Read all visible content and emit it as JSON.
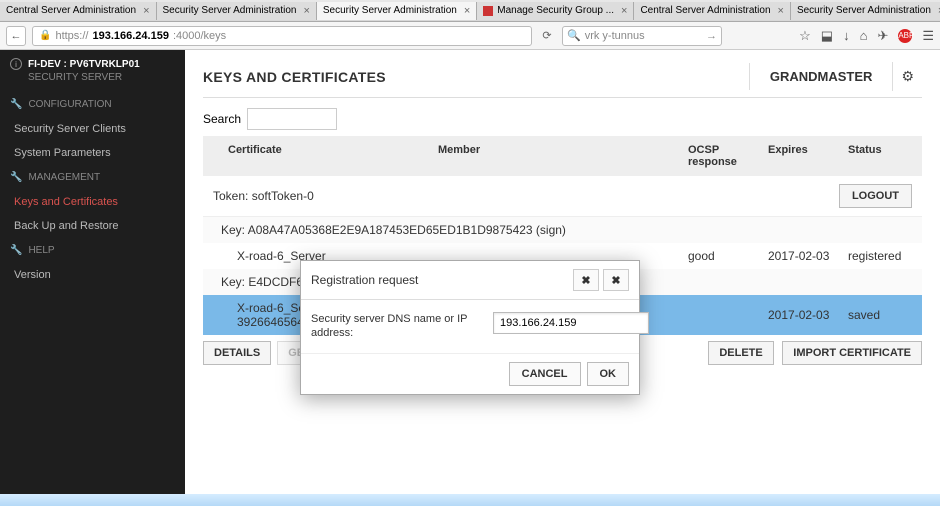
{
  "browser": {
    "tabs": [
      {
        "label": "Central Server Administration"
      },
      {
        "label": "Security Server Administration"
      },
      {
        "label": "Security Server Administration",
        "active": true
      },
      {
        "label": "Manage Security Group ..."
      },
      {
        "label": "Central Server Administration"
      },
      {
        "label": "Security Server Administration"
      }
    ],
    "url_host": "193.166.24.159",
    "url_port_path": ":4000/keys",
    "url_prefix": "https://",
    "search_placeholder": "vrk y-tunnus"
  },
  "sidebar": {
    "env": "FI-DEV : PV6TVRKLP01",
    "role": "SECURITY SERVER",
    "sections": {
      "config_label": "CONFIGURATION",
      "mgmt_label": "MANAGEMENT",
      "help_label": "HELP"
    },
    "items": {
      "clients": "Security Server Clients",
      "params": "System Parameters",
      "keys": "Keys and Certificates",
      "backup": "Back Up and Restore",
      "version": "Version"
    }
  },
  "header": {
    "title": "KEYS AND CERTIFICATES",
    "user": "GRANDMASTER"
  },
  "search_label": "Search",
  "columns": {
    "cert": "Certificate",
    "member": "Member",
    "ocsp": "OCSP response",
    "expires": "Expires",
    "status": "Status"
  },
  "token": {
    "label_prefix": "Token: ",
    "name": "softToken-0",
    "logout": "LOGOUT"
  },
  "keys": {
    "key1_prefix": "Key: ",
    "key1": "A08A47A05368E2E9A187453ED65ED1B1D9875423 (sign)",
    "key2_prefix": "Key: ",
    "key2": "E4DCDF6471F"
  },
  "rows": {
    "r1": {
      "cert": "X-road-6_Server",
      "ocsp": "good",
      "expires": "2017-02-03",
      "status": "registered"
    },
    "r2": {
      "cert": "X-road-6_Server",
      "cert2": "3926646564512",
      "expires": "2017-02-03",
      "status": "saved"
    }
  },
  "actions": {
    "details": "DETAILS",
    "genera": "GENERA",
    "delete": "DELETE",
    "import": "IMPORT CERTIFICATE"
  },
  "modal": {
    "title": "Registration request",
    "field_label": "Security server DNS name or IP address:",
    "field_value": "193.166.24.159",
    "cancel": "CANCEL",
    "ok": "OK"
  }
}
